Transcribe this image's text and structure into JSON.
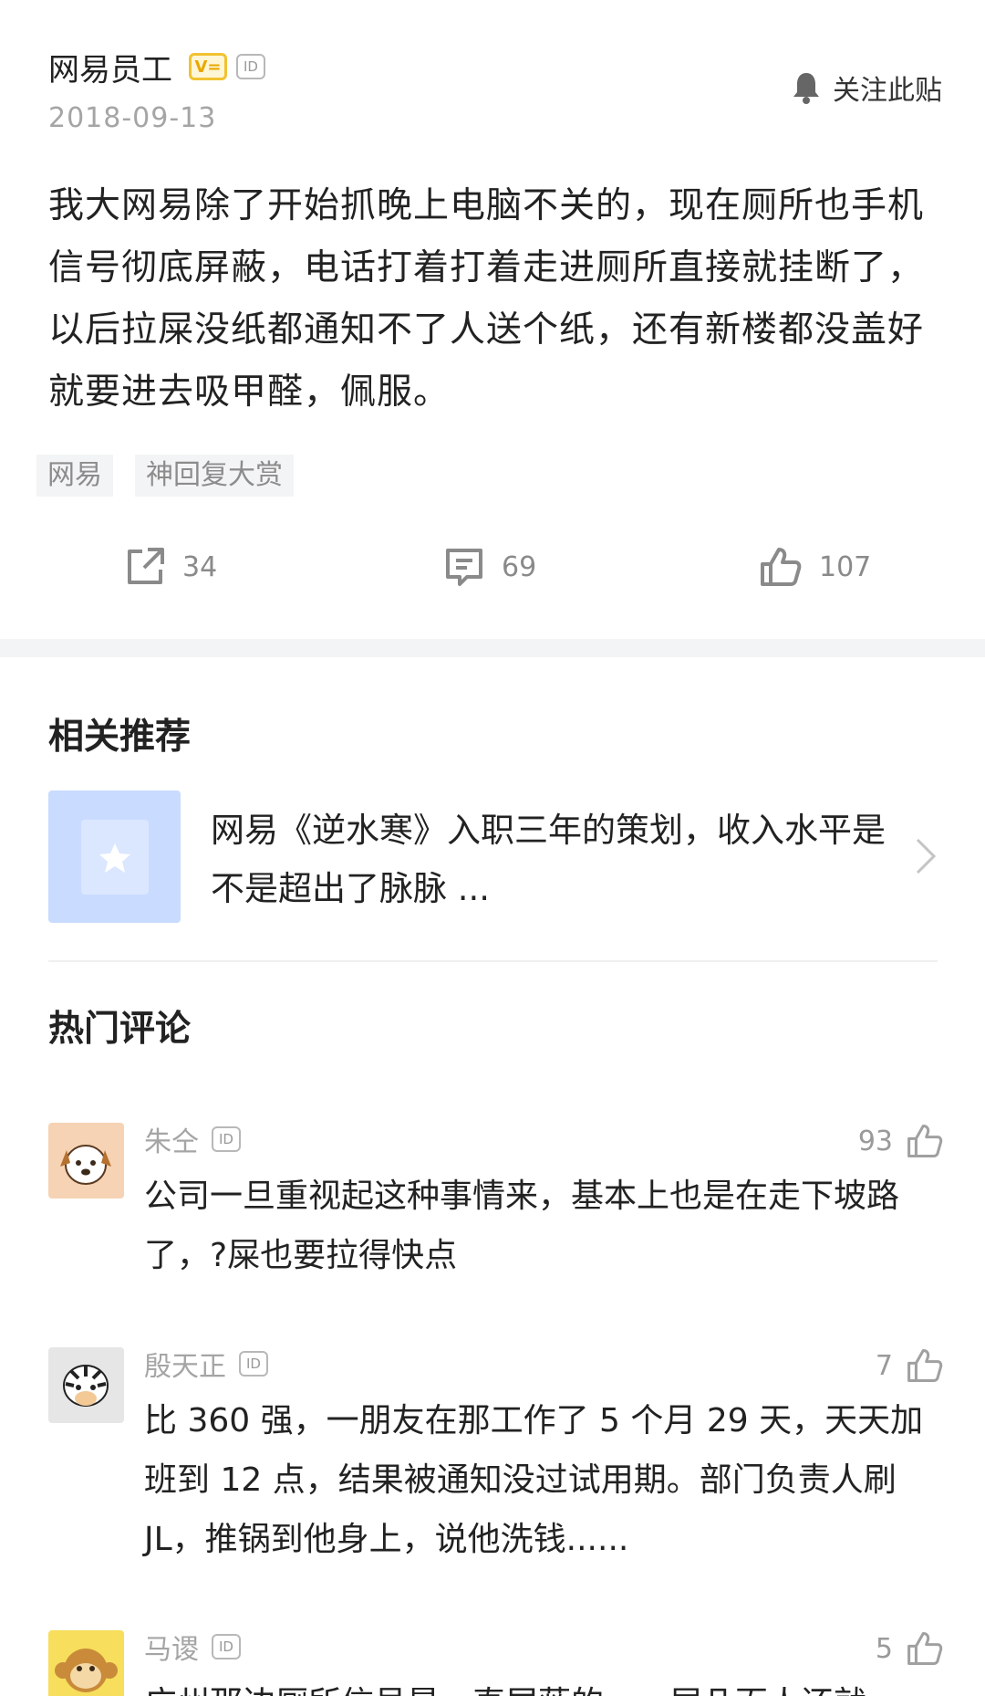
{
  "post": {
    "author": "网易员工",
    "verified_badge": "V=",
    "id_badge": "ID",
    "date": "2018-09-13",
    "follow_label": "关注此贴",
    "body": "我大网易除了开始抓晚上电脑不关的，现在厕所也手机信号彻底屏蔽，电话打着打着走进厕所直接就挂断了，以后拉屎没纸都通知不了人送个纸，还有新楼都没盖好就要进去吸甲醛，佩服。",
    "tags": [
      "网易",
      "神回复大赏"
    ],
    "share_count": "34",
    "comment_count": "69",
    "like_count": "107"
  },
  "related": {
    "title": "相关推荐",
    "item_title": "网易《逆水寒》入职三年的策划，收入水平是不是超出了脉脉 ..."
  },
  "hot_comments": {
    "title": "热门评论",
    "items": [
      {
        "name": "朱仝",
        "id_badge": "ID",
        "likes": "93",
        "text": "公司一旦重视起这种事情来，基本上也是在走下坡路了，?屎也要拉得快点"
      },
      {
        "name": "殷天正",
        "id_badge": "ID",
        "likes": "7",
        "text": "比 360 强，一朋友在那工作了 5 个月 29 天，天天加班到 12 点，结果被通知没过试用期。部门负责人刷 JL，推锅到他身上，说他洗钱......"
      },
      {
        "name": "马谡",
        "id_badge": "ID",
        "likes": "5",
        "text": "广州那边厕所信号是一直屏蔽的，一层几百人还就"
      }
    ]
  },
  "colors": {
    "verified_gold": "#f2c230",
    "muted_text": "#a5a5a5",
    "tag_bg": "#f3f4f6",
    "thumb_blue": "#c9dbff"
  }
}
